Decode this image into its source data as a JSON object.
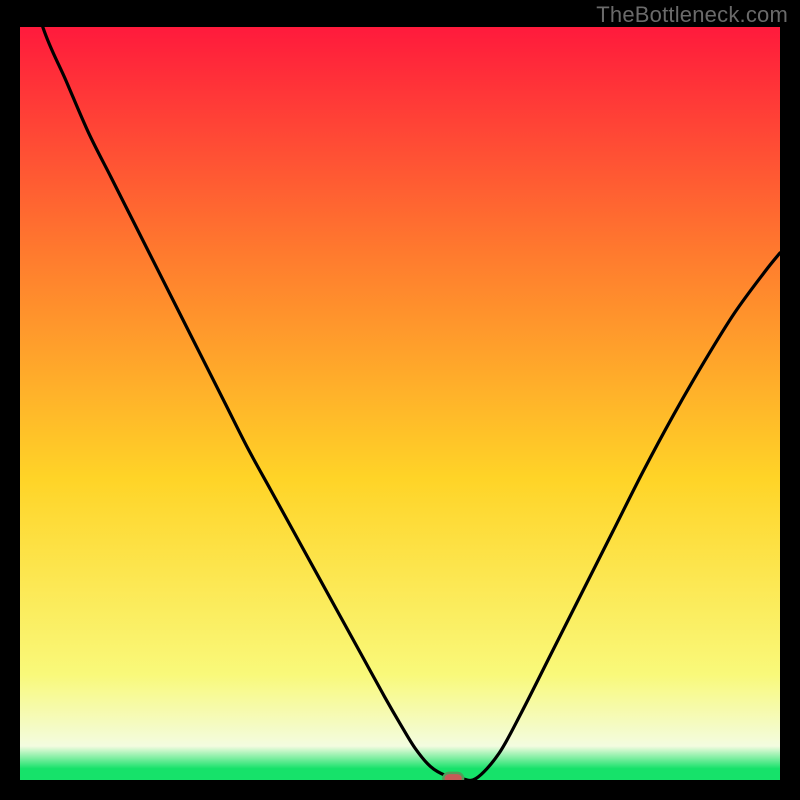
{
  "watermark": "TheBottleneck.com",
  "colors": {
    "gradient_top": "#ff1a3c",
    "gradient_mid_upper": "#ff7a2e",
    "gradient_mid": "#ffd427",
    "gradient_lower": "#f9f97a",
    "gradient_pale": "#f3fce0",
    "gradient_green": "#16e26a",
    "curve": "#000000",
    "marker_fill": "#c65a57",
    "marker_stroke": "#4fa05a",
    "frame": "#000000"
  },
  "chart_data": {
    "type": "line",
    "title": "",
    "xlabel": "",
    "ylabel": "",
    "xlim": [
      0,
      100
    ],
    "ylim": [
      0,
      100
    ],
    "series": [
      {
        "name": "bottleneck-curve",
        "x": [
          0,
          3,
          6,
          9,
          12,
          15,
          18,
          21,
          24,
          27,
          30,
          33,
          36,
          39,
          42,
          45,
          48,
          50,
          52,
          54,
          56,
          58,
          60,
          63,
          66,
          70,
          74,
          78,
          82,
          86,
          90,
          94,
          98,
          100
        ],
        "y": [
          111,
          100,
          93,
          86,
          80,
          74,
          68,
          62,
          56,
          50,
          44,
          38.5,
          33,
          27.5,
          22,
          16.5,
          11,
          7.5,
          4.2,
          1.8,
          0.6,
          0.2,
          0.2,
          3.5,
          9,
          17,
          25,
          33,
          41,
          48.5,
          55.5,
          62,
          67.5,
          70
        ]
      }
    ],
    "annotations": [
      {
        "name": "optimal-marker",
        "shape": "rounded-rect",
        "x": 57,
        "y": 0.2,
        "width_pct": 2.6,
        "height_pct": 1.5
      }
    ]
  }
}
